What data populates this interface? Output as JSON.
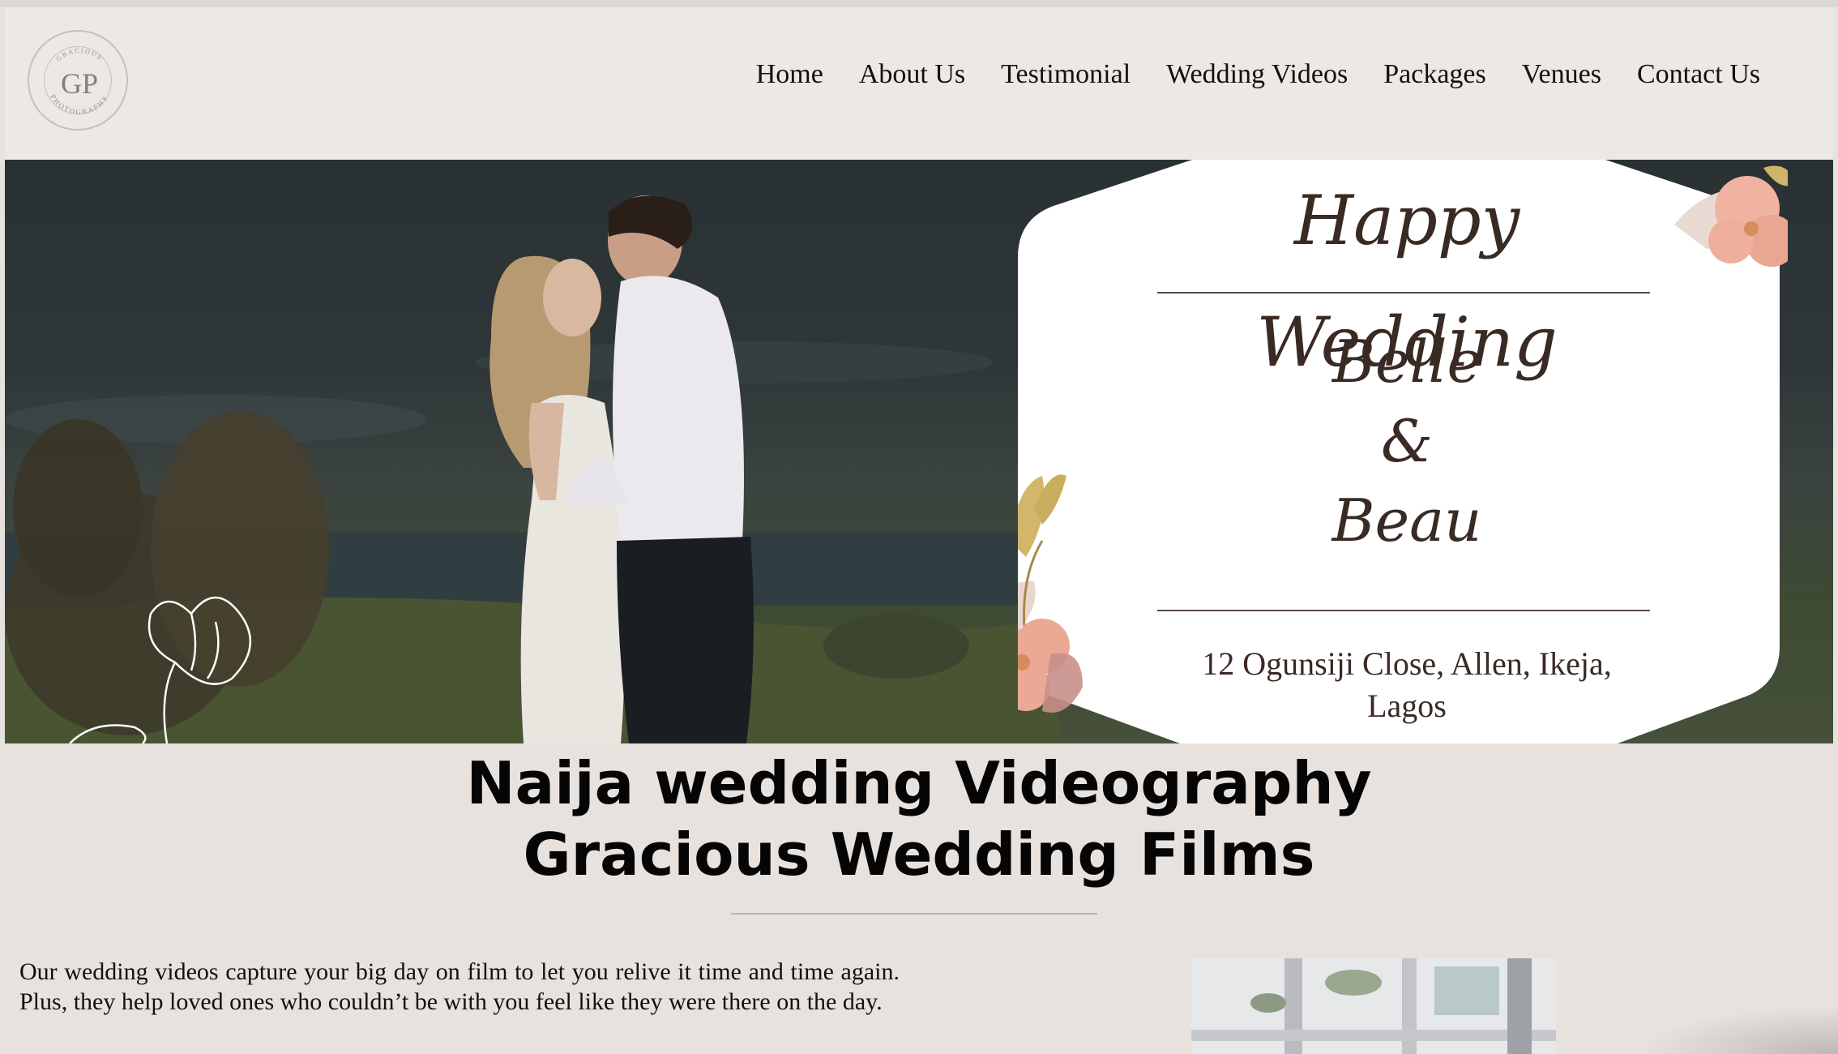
{
  "header": {
    "logo": {
      "top_text": "GRACIOUS",
      "monogram": "GP",
      "bottom_text": "PHOTOGRAPHY"
    },
    "nav": [
      {
        "label": "Home"
      },
      {
        "label": "About Us"
      },
      {
        "label": "Testimonial"
      },
      {
        "label": "Wedding Videos"
      },
      {
        "label": "Packages"
      },
      {
        "label": "Venues"
      },
      {
        "label": "Contact Us"
      }
    ]
  },
  "hero": {
    "card": {
      "title": "Happy Wedding",
      "name_one": "Belle",
      "ampersand": "&",
      "name_two": "Beau",
      "address_line1": "12 Ogunsiji Close, Allen, Ikeja,",
      "address_line2": "Lagos"
    }
  },
  "main": {
    "title_line1": "Naija wedding Videography",
    "title_line2": "Gracious Wedding Films",
    "intro": "Our wedding videos capture your big day on film to let you relive it time and time again. Plus, they help loved ones who couldn’t be with you feel like they were there on the day."
  },
  "colors": {
    "page_bg": "#e7e2de",
    "header_bg": "#ece8e5",
    "card_text": "#3a2a24"
  }
}
